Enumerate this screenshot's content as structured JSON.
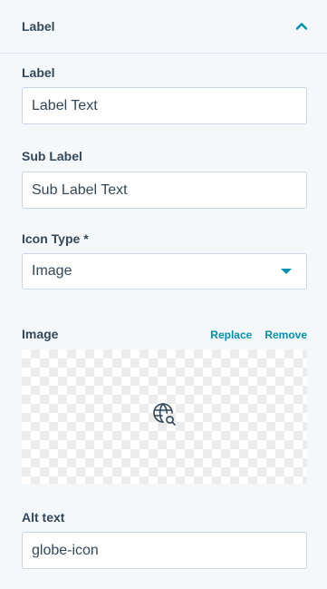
{
  "section": {
    "title": "Label",
    "expanded": true,
    "toggle_icon": "chevron-up-icon"
  },
  "fields": {
    "label": {
      "label": "Label",
      "value": "Label Text"
    },
    "sub_label": {
      "label": "Sub Label",
      "value": "Sub Label Text"
    },
    "icon_type": {
      "label": "Icon Type *",
      "value": "Image"
    },
    "image": {
      "label": "Image",
      "replace_label": "Replace",
      "remove_label": "Remove",
      "preview_icon": "globe-search-icon"
    },
    "alt_text": {
      "label": "Alt text",
      "value": "globe-icon"
    }
  },
  "colors": {
    "accent": "#0091ae",
    "text": "#33475b",
    "border": "#cbd6e2",
    "panel_bg": "#f5f8fa"
  }
}
